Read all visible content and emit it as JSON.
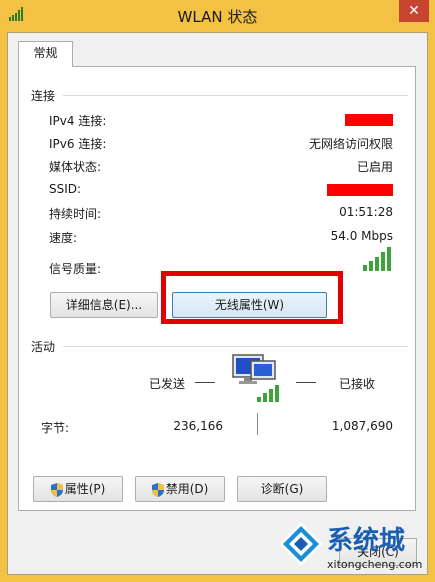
{
  "window": {
    "title": "WLAN 状态",
    "close_symbol": "✕"
  },
  "tabs": [
    {
      "label": "常规"
    }
  ],
  "connection": {
    "section_label": "连接",
    "ipv4_label": "IPv4 连接:",
    "ipv6_label": "IPv6 连接:",
    "ipv6_value": "无网络访问权限",
    "media_label": "媒体状态:",
    "media_value": "已启用",
    "ssid_label": "SSID:",
    "duration_label": "持续时间:",
    "duration_value": "01:51:28",
    "speed_label": "速度:",
    "speed_value": "54.0 Mbps",
    "signal_label": "信号质量:",
    "signal_bars": 5
  },
  "buttons": {
    "details": "详细信息(E)...",
    "wireless_props": "无线属性(W)",
    "properties": "属性(P)",
    "disable": "禁用(D)",
    "diagnose": "诊断(G)",
    "close": "关闭(C)"
  },
  "activity": {
    "section_label": "活动",
    "sent_label": "已发送",
    "received_label": "已接收",
    "bytes_label": "字节:",
    "bytes_sent": "236,166",
    "bytes_received": "1,087,690"
  },
  "watermark": {
    "brand": "系统城",
    "url": "xitongcheng.com"
  },
  "colors": {
    "title_bg": "#f3c245",
    "close_bg": "#c7452e",
    "highlight": "#e30000",
    "signal": "#3fa33c",
    "brand": "#1a5fb4"
  }
}
